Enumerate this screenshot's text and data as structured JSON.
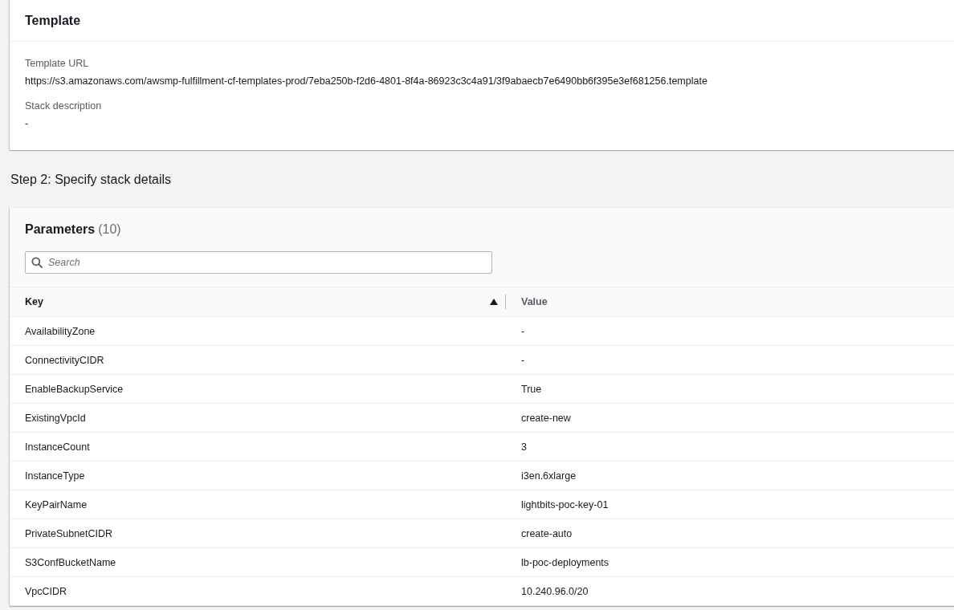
{
  "template": {
    "title": "Template",
    "fields": [
      {
        "label": "Template URL",
        "value": "https://s3.amazonaws.com/awsmp-fulfillment-cf-templates-prod/7eba250b-f2d6-4801-8f4a-86923c3c4a91/3f9abaecb7e6490bb6f395e3ef681256.template"
      },
      {
        "label": "Stack description",
        "value": "-"
      }
    ]
  },
  "step_title": "Step 2: Specify stack details",
  "parameters": {
    "title": "Parameters",
    "count": "(10)",
    "search": {
      "placeholder": "Search"
    },
    "columns": [
      {
        "label": "Key",
        "sorted": true
      },
      {
        "label": "Value",
        "sorted": false
      }
    ],
    "rows": [
      {
        "key": "AvailabilityZone",
        "value": "-"
      },
      {
        "key": "ConnectivityCIDR",
        "value": "-"
      },
      {
        "key": "EnableBackupService",
        "value": "True"
      },
      {
        "key": "ExistingVpcId",
        "value": "create-new"
      },
      {
        "key": "InstanceCount",
        "value": "3"
      },
      {
        "key": "InstanceType",
        "value": "i3en.6xlarge"
      },
      {
        "key": "KeyPairName",
        "value": "lightbits-poc-key-01"
      },
      {
        "key": "PrivateSubnetCIDR",
        "value": "create-auto"
      },
      {
        "key": "S3ConfBucketName",
        "value": "lb-poc-deployments"
      },
      {
        "key": "VpcCIDR",
        "value": "10.240.96.0/20"
      }
    ]
  }
}
